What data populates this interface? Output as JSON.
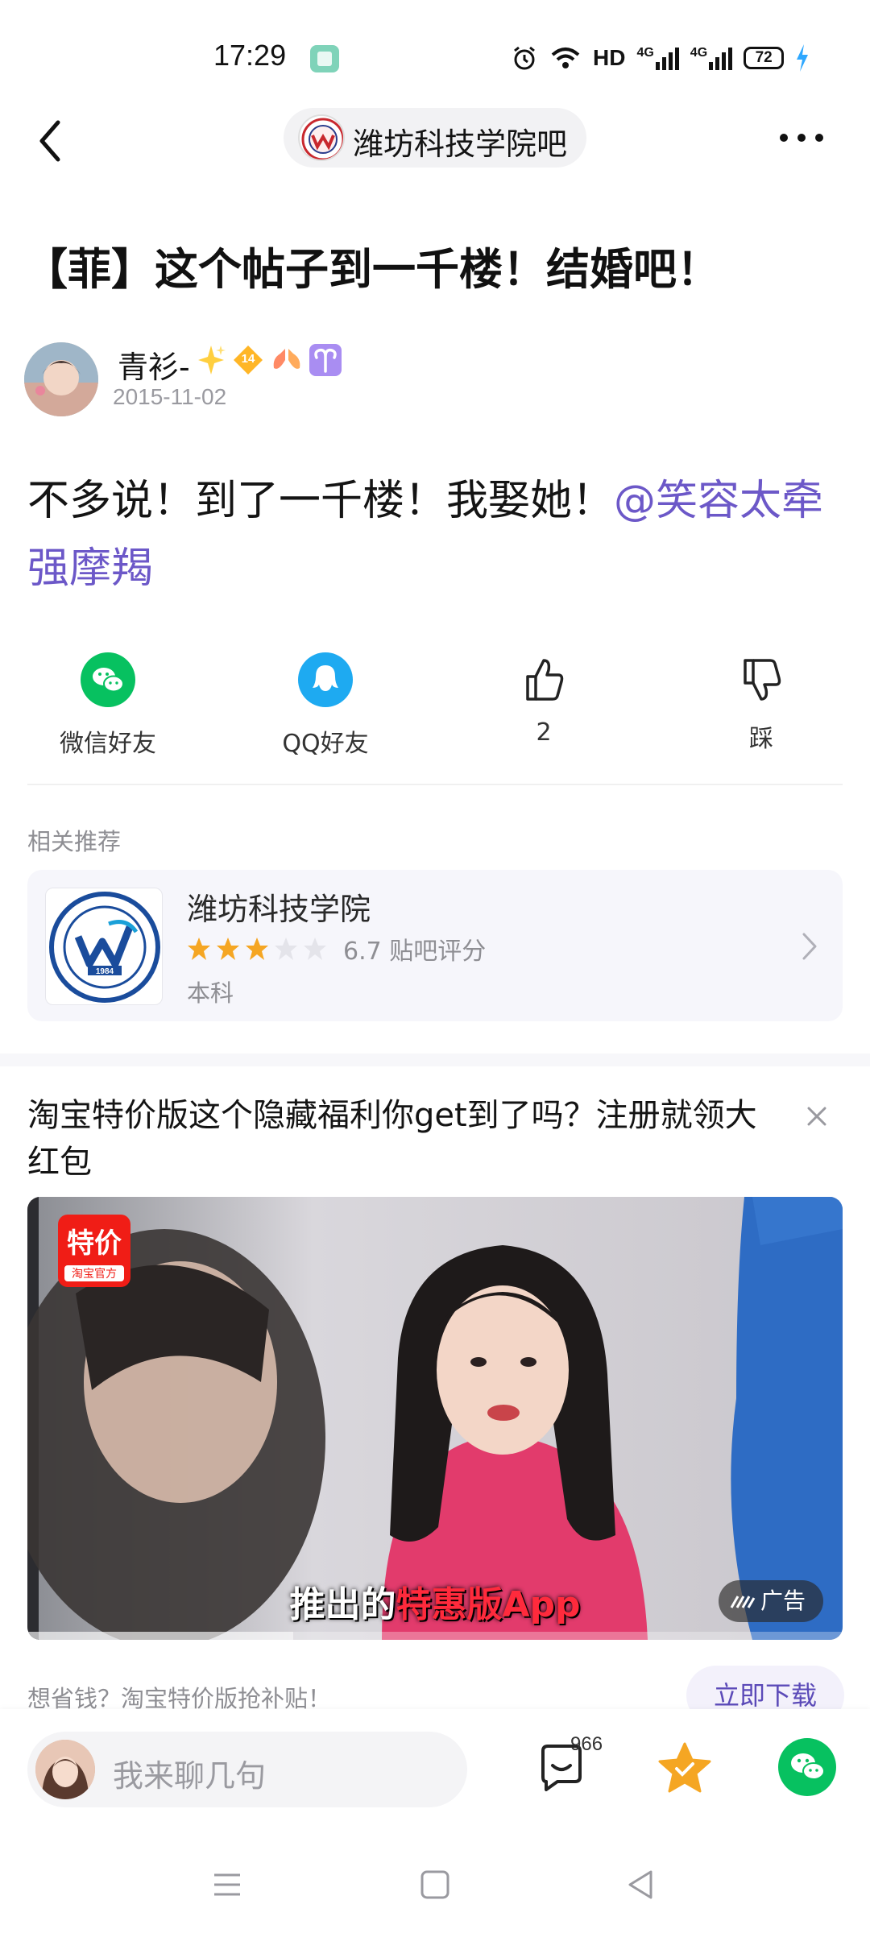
{
  "status_bar": {
    "time": "17:29",
    "network_label": "HD",
    "signal1_label": "4G",
    "signal2_label": "4G",
    "battery": "72"
  },
  "nav": {
    "forum_name": "潍坊科技学院吧"
  },
  "post": {
    "title": "【菲】这个帖子到一千楼！结婚吧！",
    "author": "青衫-",
    "level_badge": "14",
    "date": "2015-11-02",
    "body_text": "不多说！到了一千楼！我娶她！",
    "mention": "@笑容太牵强摩羯"
  },
  "share": {
    "wechat_label": "微信好友",
    "qq_label": "QQ好友",
    "like_count": "2",
    "dislike_label": "踩"
  },
  "related": {
    "section_label": "相关推荐",
    "name": "潍坊科技学院",
    "rating_stars": 3,
    "rating_text": "6.7 贴吧评分",
    "type": "本科",
    "logo_year": "1984"
  },
  "ad": {
    "title": "淘宝特价版这个隐藏福利你get到了吗？注册就领大红包",
    "badge_main": "特价",
    "badge_sub": "淘宝官方",
    "subtitle_pre": "推出的",
    "subtitle_hl": "特惠版App",
    "ad_tag": "广告",
    "footer_text": "想省钱？淘宝特价版抢补贴！",
    "download_label": "立即下载"
  },
  "bottom_bar": {
    "comment_placeholder": "我来聊几句",
    "comment_count": "966"
  },
  "colors": {
    "accent": "#6c58c8",
    "wechat": "#07c160",
    "qq": "#1eaaf1",
    "star": "#f5a623",
    "ad_red": "#f01d16"
  }
}
